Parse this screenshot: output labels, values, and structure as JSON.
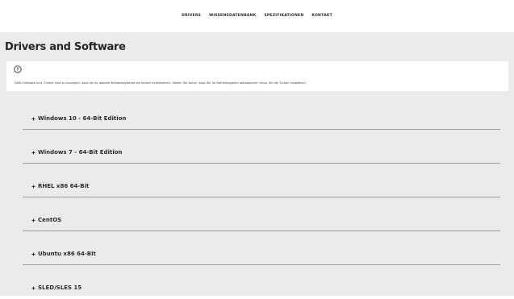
{
  "nav": {
    "items": [
      "DRIVERS",
      "WISSENSDATENBANK",
      "SPEZIFIKATIONEN",
      "KONTAKT"
    ]
  },
  "panel": {
    "title": "Drivers and Software",
    "info_icon": "info-circle-icon",
    "info_text": "AMD-Software und -Treiber sind so konzipiert, dass die für aktuelle Betriebssysteme am besten funktionieren. Stellen Sie sicher, dass Sie Ihr Betriebssystem aktualisieren, bevor Sie die Treiber installieren."
  },
  "os_list": {
    "expand_icon": "plus-icon",
    "items": [
      "Windows 10 - 64-Bit Edition",
      "Windows 7 - 64-Bit Edition",
      "RHEL x86 64-Bit",
      "CentOS",
      "Ubuntu x86 64-Bit",
      "SLED/SLES 15"
    ]
  },
  "colors": {
    "panel_background": "#ebebeb",
    "divider": "#9c9c9c",
    "text": "#262626"
  }
}
